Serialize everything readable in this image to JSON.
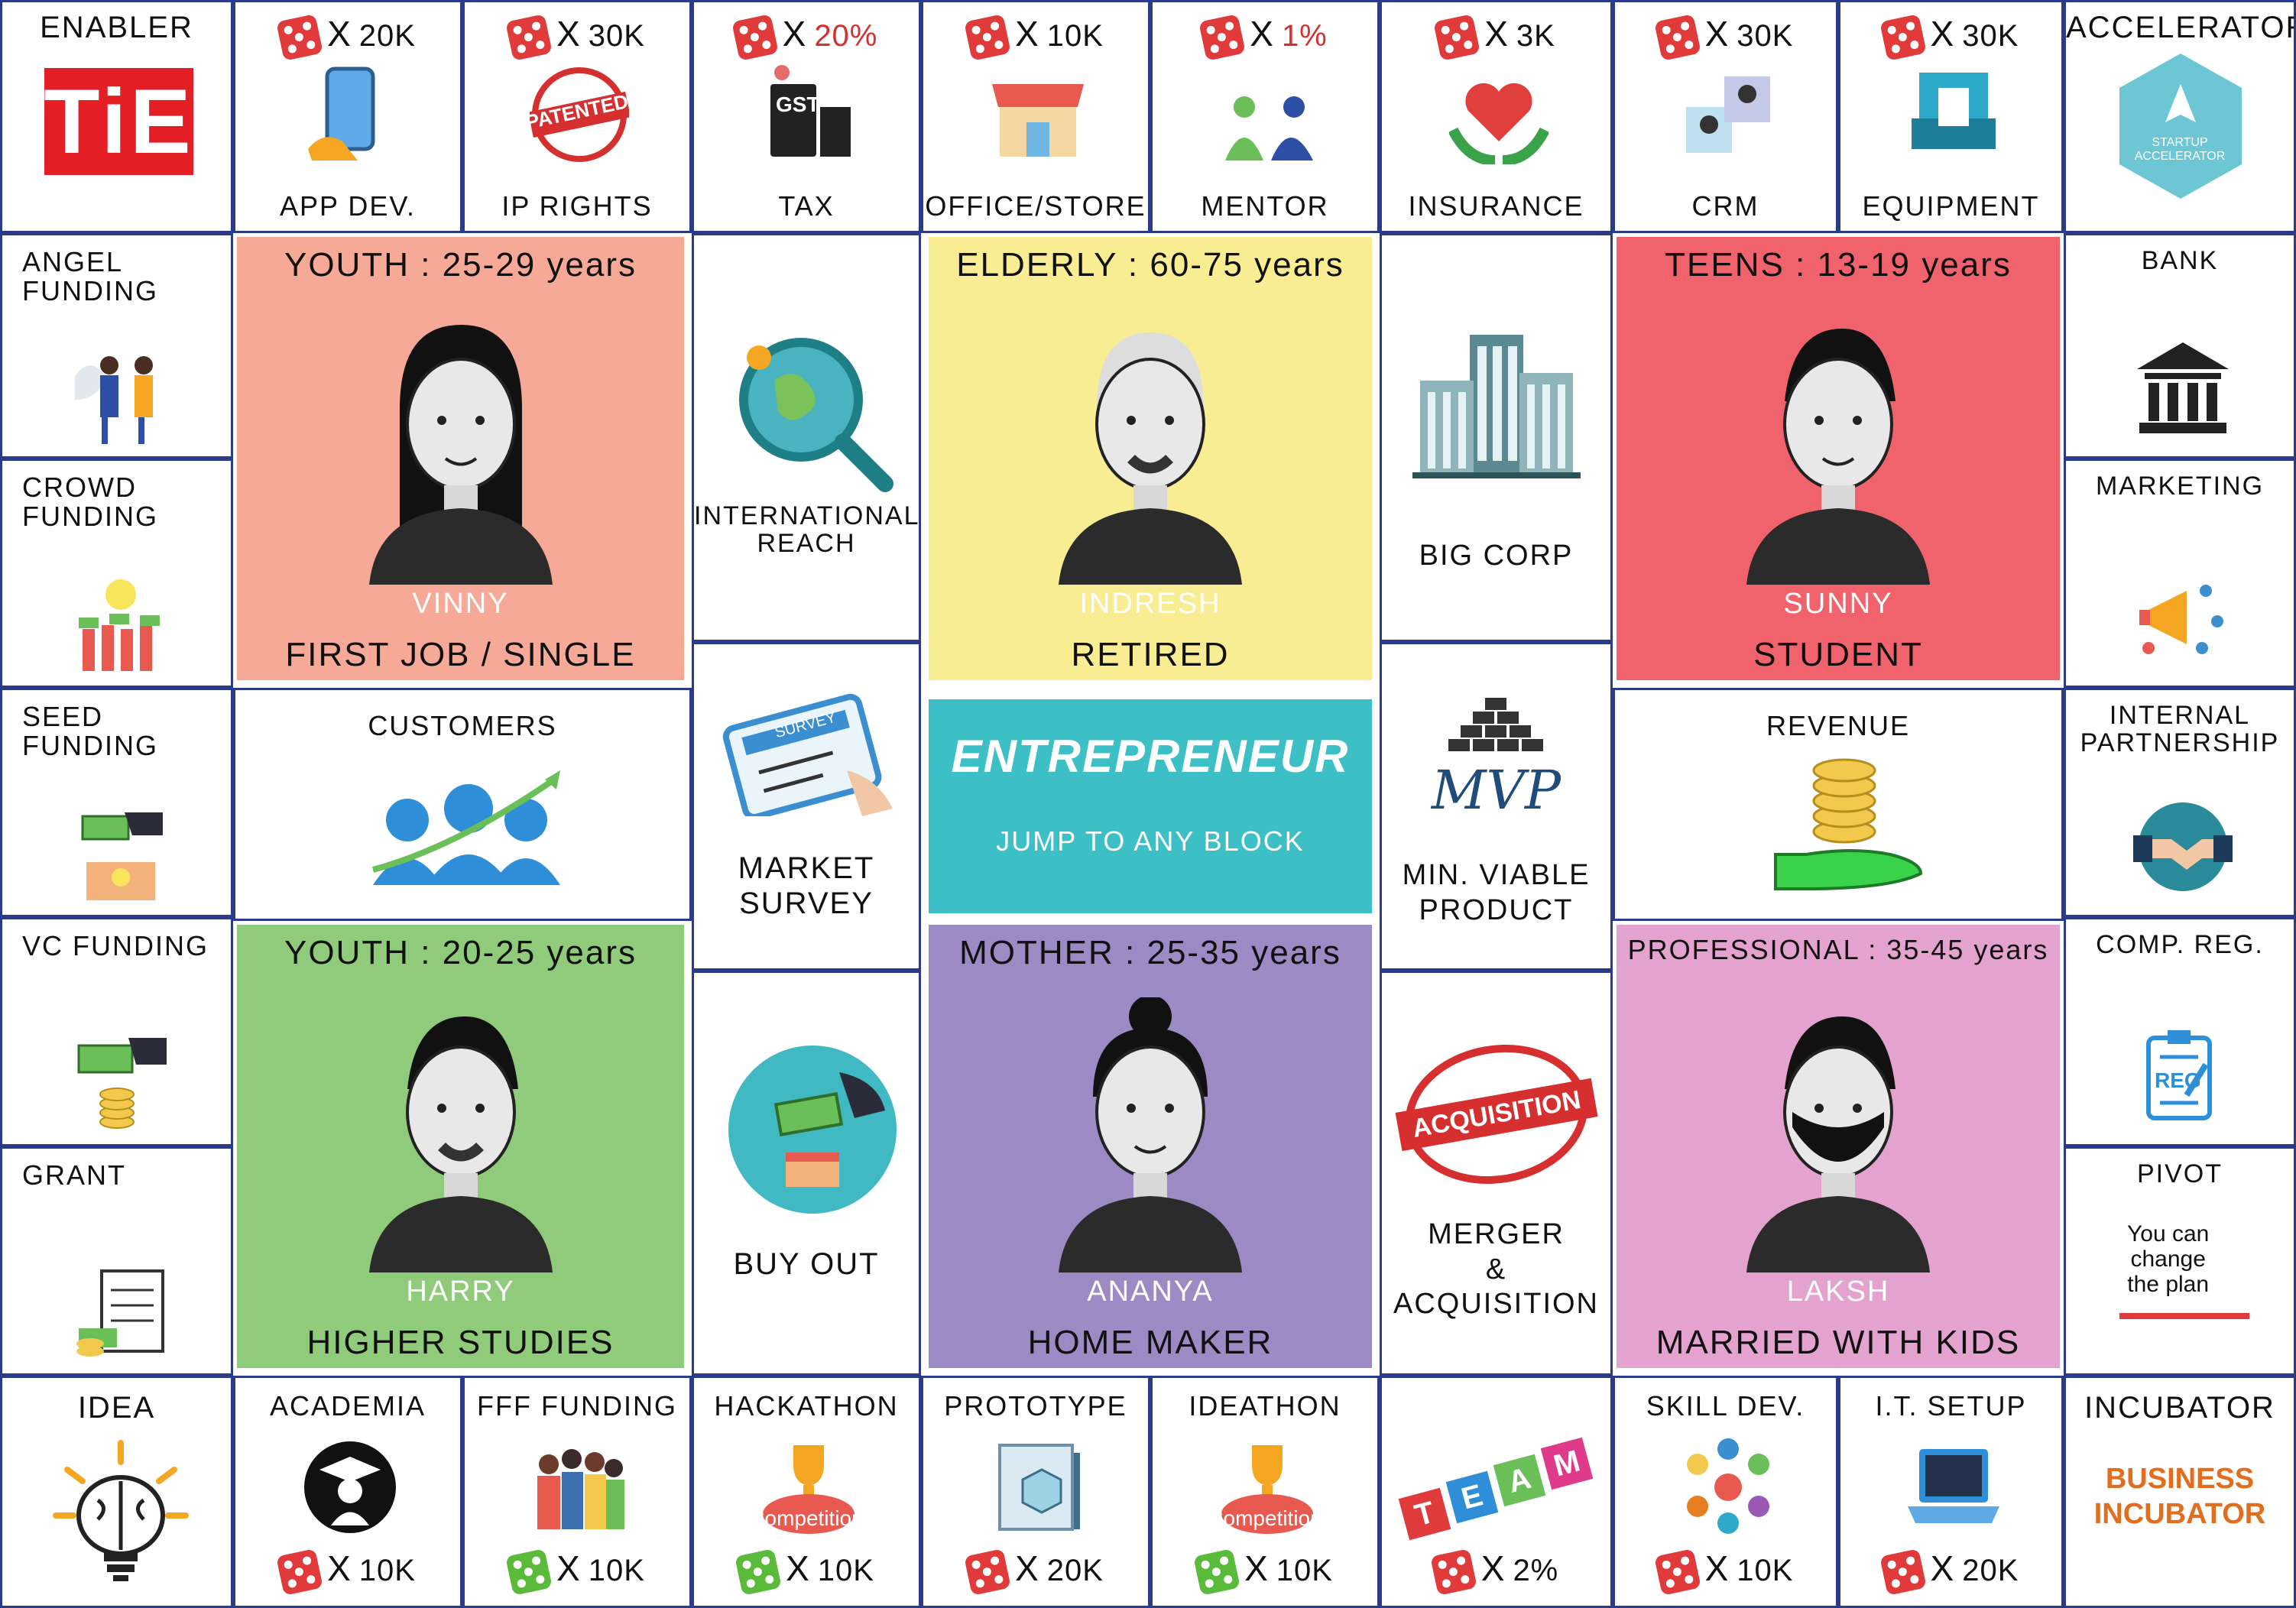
{
  "corners": {
    "enabler": "ENABLER",
    "enabler_logo": "TiE",
    "accelerator": "ACCELERATOR",
    "accelerator_badge": "STARTUP\nACCELERATOR",
    "idea": "IDEA",
    "incubator": "INCUBATOR",
    "incubator_words": "BUSINESS\nINCUBATOR"
  },
  "top_row": [
    {
      "label": "APP DEV.",
      "multiplier": "20K",
      "icon": "smartphone-hand-icon"
    },
    {
      "label": "IP RIGHTS",
      "multiplier": "30K",
      "icon": "patented-stamp-icon",
      "stamp_text": "PATENTED"
    },
    {
      "label": "TAX",
      "multiplier": "20%",
      "icon": "gst-icon",
      "icon_text": "GST"
    },
    {
      "label": "OFFICE/STORE",
      "multiplier": "10K",
      "icon": "storefront-icon"
    },
    {
      "label": "MENTOR",
      "multiplier": "1%",
      "icon": "mentor-watering-icon"
    },
    {
      "label": "INSURANCE",
      "multiplier": "3K",
      "icon": "heart-hands-icon"
    },
    {
      "label": "CRM",
      "multiplier": "30K",
      "icon": "crm-profiles-icon"
    },
    {
      "label": "EQUIPMENT",
      "multiplier": "30K",
      "icon": "printer-machine-icon"
    }
  ],
  "bottom_row": [
    {
      "label": "ACADEMIA",
      "multiplier": "10K",
      "dice": "red",
      "icon": "graduate-icon"
    },
    {
      "label": "FFF FUNDING",
      "multiplier": "10K",
      "dice": "green",
      "icon": "family-group-icon"
    },
    {
      "label": "HACKATHON",
      "multiplier": "10K",
      "dice": "green",
      "icon": "trophy-competition-icon",
      "badge": "Competition"
    },
    {
      "label": "PROTOTYPE",
      "multiplier": "20K",
      "dice": "red",
      "icon": "blueprint-icon"
    },
    {
      "label": "IDEATHON",
      "multiplier": "10K",
      "dice": "green",
      "icon": "trophy-competition-icon",
      "badge": "Competition"
    },
    {
      "label": "",
      "multiplier": "2%",
      "dice": "red",
      "icon": "team-blocks-icon",
      "blocks": [
        "T",
        "E",
        "A",
        "M"
      ]
    },
    {
      "label": "SKILL DEV.",
      "multiplier": "10K",
      "dice": "red",
      "icon": "skills-circle-icon"
    },
    {
      "label": "I.T. SETUP",
      "multiplier": "20K",
      "dice": "red",
      "icon": "laptop-icon"
    }
  ],
  "left_col": [
    {
      "label": "ANGEL\nFUNDING",
      "icon": "angel-investor-icon"
    },
    {
      "label": "CROWD\nFUNDING",
      "icon": "crowd-money-icon"
    },
    {
      "label": "SEED\nFUNDING",
      "icon": "seed-box-icon"
    },
    {
      "label": "VC FUNDING",
      "icon": "vc-coins-icon"
    },
    {
      "label": "GRANT",
      "icon": "grant-document-icon"
    }
  ],
  "right_col": [
    {
      "label": "BANK",
      "icon": "bank-icon"
    },
    {
      "label": "MARKETING",
      "icon": "megaphone-icon"
    },
    {
      "label": "INTERNAL\nPARTNERSHIP",
      "icon": "handshake-icon"
    },
    {
      "label": "COMP. REG.",
      "icon": "registration-clipboard-icon",
      "icon_text": "REG"
    },
    {
      "label": "PIVOT",
      "icon": "pivot-arrows-icon",
      "note": "You can\nchange\nthe plan"
    }
  ],
  "inner_blocks": {
    "international_reach": "INTERNATIONAL\nREACH",
    "market_survey": "MARKET\nSURVEY",
    "survey_card": "SURVEY",
    "buy_out": "BUY OUT",
    "big_corp": "BIG CORP",
    "mvp": "MIN. VIABLE\nPRODUCT",
    "mvp_mark": "MVP",
    "merger": "MERGER\n&\nACQUISITION",
    "acquisition_stamp": "ACQUISITION",
    "customers": "CUSTOMERS",
    "revenue": "REVENUE"
  },
  "center": {
    "title": "ENTREPRENEUR",
    "subtitle": "JUMP TO ANY BLOCK",
    "color": "#3dbfc6"
  },
  "characters": [
    {
      "key": "vinny",
      "title": "YOUTH : 25-29 years",
      "name": "VINNY",
      "status": "FIRST JOB / SINGLE",
      "color": "#f7a997"
    },
    {
      "key": "indresh",
      "title": "ELDERLY : 60-75 years",
      "name": "INDRESH",
      "status": "RETIRED",
      "color": "#f9ed93"
    },
    {
      "key": "sunny",
      "title": "TEENS : 13-19 years",
      "name": "SUNNY",
      "status": "STUDENT",
      "color": "#f0636d"
    },
    {
      "key": "harry",
      "title": "YOUTH : 20-25 years",
      "name": "HARRY",
      "status": "HIGHER STUDIES",
      "color": "#8fcb7a"
    },
    {
      "key": "ananya",
      "title": "MOTHER : 25-35 years",
      "name": "ANANYA",
      "status": "HOME MAKER",
      "color": "#9b8ac4"
    },
    {
      "key": "laksh",
      "title": "PROFESSIONAL : 35-45 years",
      "name": "LAKSH",
      "status": "MARRIED WITH KIDS",
      "color": "#e4a3ce"
    }
  ],
  "colors": {
    "border": "#2c3a8a",
    "dice_red": "#e03a3a",
    "dice_green": "#5aba3a",
    "tie_red": "#e31e25"
  },
  "x_symbol": "X"
}
